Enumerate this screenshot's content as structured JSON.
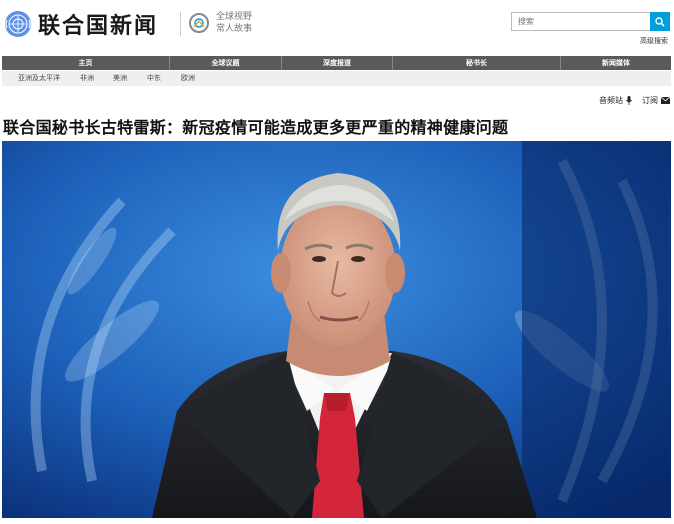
{
  "header": {
    "site_title": "联合国新闻",
    "tagline_line1": "全球视野",
    "tagline_line2": "常人故事",
    "search_placeholder": "搜索",
    "advanced_search": "高级搜索"
  },
  "main_nav": [
    "主页",
    "全球议题",
    "深度报道",
    "秘书长",
    "新闻媒体"
  ],
  "sub_nav": [
    "亚洲及太平洋",
    "非洲",
    "美洲",
    "中东",
    "欧洲"
  ],
  "utility": {
    "audio": "音频站",
    "subscribe": "订阅"
  },
  "article": {
    "headline": "联合国秘书长古特雷斯：新冠疫情可能造成更多更严重的精神健康问题"
  },
  "colors": {
    "accent": "#009edb",
    "nav_bg": "#5a5a5a",
    "subnav_bg": "#efefef"
  }
}
